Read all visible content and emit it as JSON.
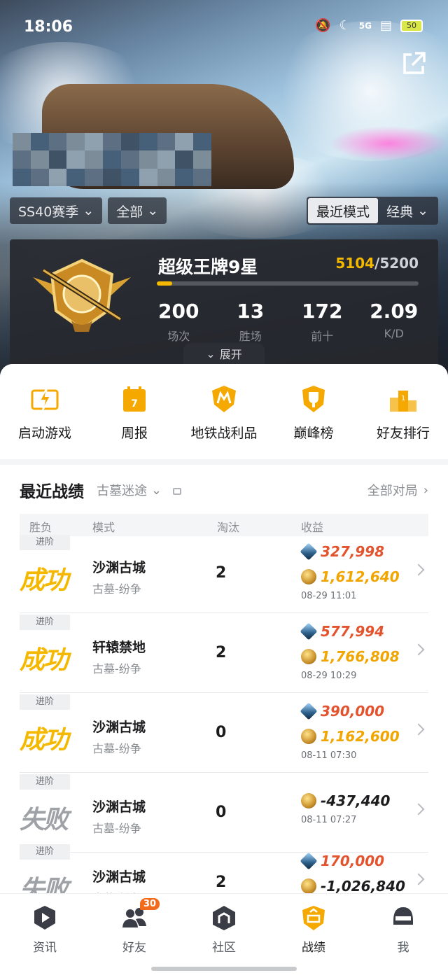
{
  "status_bar": {
    "time": "18:06",
    "network": "5G",
    "battery": "50"
  },
  "header": {
    "season_filter": "SS40赛季",
    "scope_filter": "全部",
    "mode_tabs": [
      "最近模式",
      "经典"
    ]
  },
  "rank": {
    "title": "超级王牌9星",
    "points_current": "5104",
    "points_total": "/5200",
    "progress_fraction": 0.06,
    "stats": [
      {
        "value": "200",
        "label": "场次"
      },
      {
        "value": "13",
        "label": "胜场"
      },
      {
        "value": "172",
        "label": "前十"
      },
      {
        "value": "2.09",
        "label": "K/D"
      }
    ],
    "expand_label": "展开"
  },
  "quick_actions": [
    {
      "label": "启动游戏",
      "icon": "lightning-icon"
    },
    {
      "label": "周报",
      "icon": "calendar-icon"
    },
    {
      "label": "地铁战利品",
      "icon": "metro-shield-icon"
    },
    {
      "label": "巅峰榜",
      "icon": "trophy-shield-icon"
    },
    {
      "label": "好友排行",
      "icon": "podium-icon"
    }
  ],
  "recent": {
    "title": "最近战绩",
    "filter": "古墓迷途",
    "all_matches": "全部对局",
    "columns": [
      "胜负",
      "模式",
      "淘汰",
      "收益"
    ],
    "rows": [
      {
        "tag": "进阶",
        "result": "成功",
        "win": true,
        "map": "沙渊古城",
        "sub": "古墓-纷争",
        "kills": "2",
        "gems": "327,998",
        "coins": "1,612,640",
        "date": "08-29 11:01"
      },
      {
        "tag": "进阶",
        "result": "成功",
        "win": true,
        "map": "轩辕禁地",
        "sub": "古墓-纷争",
        "kills": "2",
        "gems": "577,994",
        "coins": "1,766,808",
        "date": "08-29 10:29"
      },
      {
        "tag": "进阶",
        "result": "成功",
        "win": true,
        "map": "沙渊古城",
        "sub": "古墓-纷争",
        "kills": "0",
        "gems": "390,000",
        "coins": "1,162,600",
        "date": "08-11 07:30"
      },
      {
        "tag": "进阶",
        "result": "失败",
        "win": false,
        "map": "沙渊古城",
        "sub": "古墓-纷争",
        "kills": "0",
        "gems": null,
        "coins": "-437,440",
        "date": "08-11 07:27"
      },
      {
        "tag": "进阶",
        "result": "失败",
        "win": false,
        "map": "沙渊古城",
        "sub": "古墓-纷争",
        "kills": "2",
        "gems": "170,000",
        "coins": "-1,026,840",
        "date": ""
      }
    ]
  },
  "tabbar": [
    {
      "label": "资讯",
      "icon": "play-news-icon",
      "active": false
    },
    {
      "label": "好友",
      "icon": "friends-icon",
      "badge": "30",
      "active": false
    },
    {
      "label": "社区",
      "icon": "community-icon",
      "active": false
    },
    {
      "label": "战绩",
      "icon": "record-shield-icon",
      "active": true
    },
    {
      "label": "我",
      "icon": "helmet-icon",
      "active": false
    }
  ],
  "colors": {
    "accent": "#f5b800",
    "gem_value": "#e2532e",
    "coin_value": "#f0a500",
    "lose": "#9ea1a6"
  }
}
